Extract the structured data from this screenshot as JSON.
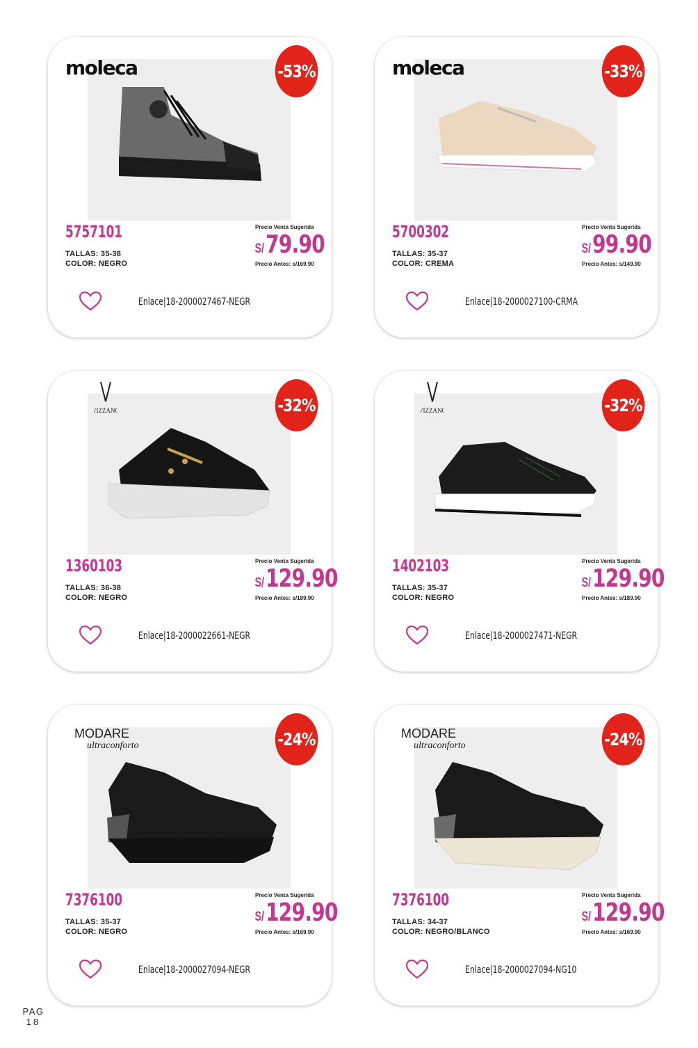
{
  "page": {
    "label": "PAG",
    "number": "18"
  },
  "common": {
    "price_label": "Precio Venta Sugerida",
    "currency": "S/"
  },
  "products": [
    {
      "brand": "moleca",
      "discount": "-53%",
      "code": "5757101",
      "tallas": "TALLAS: 35-38",
      "color": "COLOR: NEGRO",
      "price": "79.90",
      "price_before": "Precio Antes: s/169.90",
      "link": "Enlace|18-2000027467-NEGR"
    },
    {
      "brand": "moleca",
      "discount": "-33%",
      "code": "5700302",
      "tallas": "TALLAS: 35-37",
      "color": "COLOR: CREMA",
      "price": "99.90",
      "price_before": "Precio Antes: s/149.90",
      "link": "Enlace|18-2000027100-CRMA"
    },
    {
      "brand": "VIZZANO",
      "discount": "-32%",
      "code": "1360103",
      "tallas": "TALLAS: 36-38",
      "color": "COLOR: NEGRO",
      "price": "129.90",
      "price_before": "Precio Antes: s/189.90",
      "link": "Enlace|18-2000022661-NEGR"
    },
    {
      "brand": "VIZZANO",
      "discount": "-32%",
      "code": "1402103",
      "tallas": "TALLAS: 35-37",
      "color": "COLOR: NEGRO",
      "price": "129.90",
      "price_before": "Precio Antes: s/189.90",
      "link": "Enlace|18-2000027471-NEGR"
    },
    {
      "brand": "MODARE ultraconforto",
      "discount": "-24%",
      "code": "7376100",
      "tallas": "TALLAS: 35-37",
      "color": "COLOR: NEGRO",
      "price": "129.90",
      "price_before": "Precio Antes: s/169.90",
      "link": "Enlace|18-2000027094-NEGR"
    },
    {
      "brand": "MODARE ultraconforto",
      "discount": "-24%",
      "code": "7376100",
      "tallas": "TALLAS: 34-37",
      "color": "COLOR: NEGRO/BLANCO",
      "price": "129.90",
      "price_before": "Precio Antes: s/169.90",
      "link": "Enlace|18-2000027094-NG10"
    }
  ],
  "colors": {
    "accent": "#c2388f",
    "discount_badge": "#e2231a",
    "photo_bg": "#eeeeee"
  }
}
